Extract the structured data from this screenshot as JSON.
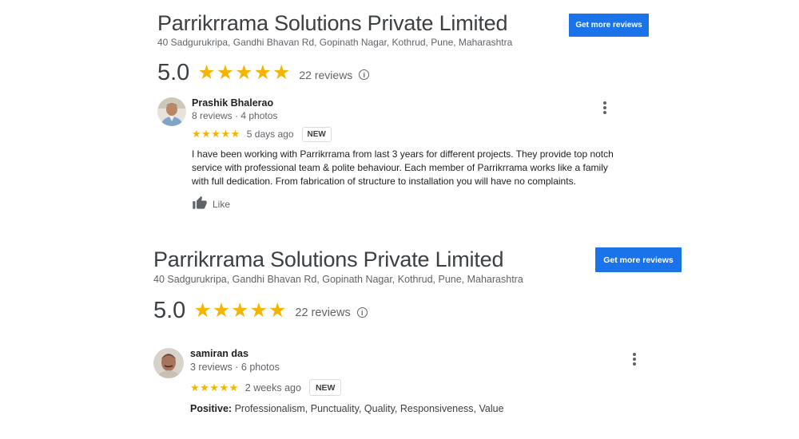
{
  "cards": [
    {
      "business_name": "Parrikrrama Solutions Private Limited",
      "address": "40 Sadgurukripa, Gandhi Bhavan Rd, Gopinath Nagar, Kothrud, Pune, Maharashtra",
      "cta_label": "Get more reviews",
      "rating": "5.0",
      "stars": "★★★★★",
      "review_count": "22 reviews",
      "info_icon": "i",
      "review": {
        "reviewer_name": "Prashik Bhalerao",
        "reviewer_meta": "8 reviews · 4 photos",
        "stars": "★★★★★",
        "age": "5 days ago",
        "badge": "NEW",
        "text": "I have been working with Parrikrrama from last 3 years for different projects. They provide top notch service with professional team & polite behaviour. Each member of Parrikrrama works like a family with full dedication. From fabrication of structure to installation you will have no complaints.",
        "like_label": "Like"
      }
    },
    {
      "business_name": "Parrikrrama Solutions Private Limited",
      "address": "40 Sadgurukripa, Gandhi Bhavan Rd, Gopinath Nagar, Kothrud, Pune, Maharashtra",
      "cta_label": "Get more reviews",
      "rating": "5.0",
      "stars": "★★★★★",
      "review_count": "22 reviews",
      "info_icon": "i",
      "review": {
        "reviewer_name": "samiran das",
        "reviewer_meta": "3 reviews · 6 photos",
        "stars": "★★★★★",
        "age": "2 weeks ago",
        "badge": "NEW",
        "positive_label": "Positive:",
        "positive_text": " Professionalism, Punctuality, Quality, Responsiveness, Value"
      }
    }
  ],
  "colors": {
    "star": "#f4b400",
    "button": "#1a73e8",
    "muted_text": "#5f6368"
  }
}
